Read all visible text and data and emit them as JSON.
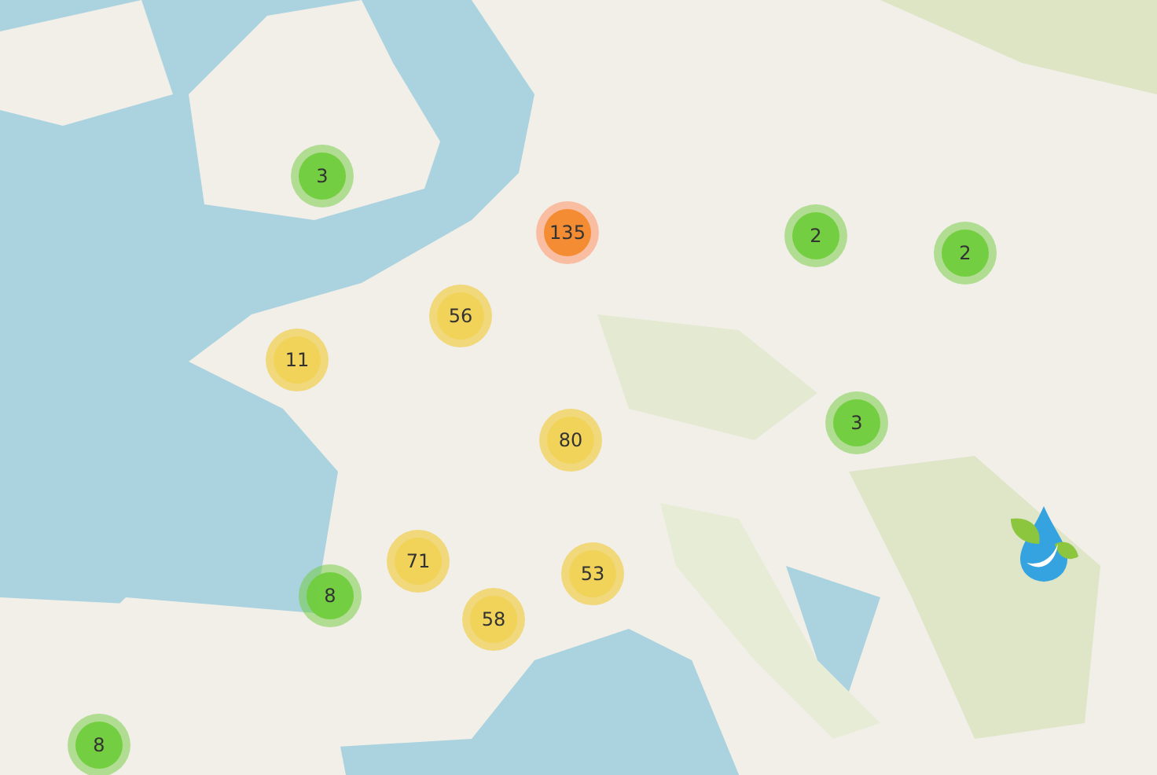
{
  "clusters": [
    {
      "count": "3",
      "kind": "small"
    },
    {
      "count": "135",
      "kind": "large"
    },
    {
      "count": "2",
      "kind": "small"
    },
    {
      "count": "2",
      "kind": "small"
    },
    {
      "count": "56",
      "kind": "medium"
    },
    {
      "count": "11",
      "kind": "medium"
    },
    {
      "count": "80",
      "kind": "medium"
    },
    {
      "count": "3",
      "kind": "small"
    },
    {
      "count": "71",
      "kind": "medium"
    },
    {
      "count": "53",
      "kind": "medium"
    },
    {
      "count": "8",
      "kind": "small"
    },
    {
      "count": "58",
      "kind": "medium"
    },
    {
      "count": "8",
      "kind": "small"
    }
  ]
}
